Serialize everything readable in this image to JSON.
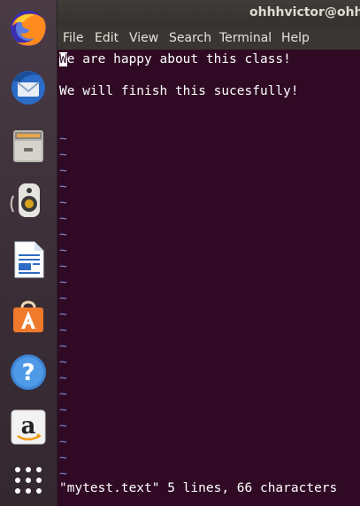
{
  "window": {
    "title": "ohhhvictor@ohhh"
  },
  "menu": {
    "items": [
      "File",
      "Edit",
      "View",
      "Search",
      "Terminal",
      "Help"
    ]
  },
  "dock": {
    "items": [
      {
        "name": "firefox-icon"
      },
      {
        "name": "thunderbird-icon"
      },
      {
        "name": "files-icon"
      },
      {
        "name": "rhythmbox-icon"
      },
      {
        "name": "libreoffice-writer-icon"
      },
      {
        "name": "software-center-icon"
      },
      {
        "name": "help-icon"
      },
      {
        "name": "amazon-icon"
      },
      {
        "name": "show-applications-icon"
      }
    ]
  },
  "editor": {
    "line1_cursor_char": "W",
    "line1_rest": "e are happy about this class!",
    "line2": "",
    "line3": "We will finish this sucesfully!",
    "tilde": "~",
    "status": "\"mytest.text\" 5 lines, 66 characters"
  },
  "colors": {
    "terminal_bg": "#300a24",
    "tilde": "#7f8cd8",
    "text": "#ffffff"
  }
}
